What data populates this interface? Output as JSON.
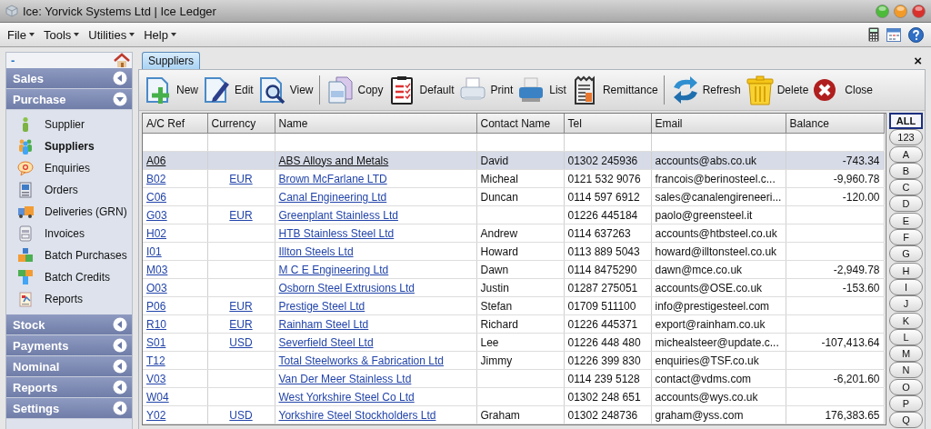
{
  "window": {
    "title": "Ice: Yorvick Systems Ltd | Ice Ledger"
  },
  "menu": [
    "File",
    "Tools",
    "Utilities",
    "Help"
  ],
  "sidebar": {
    "header": "-",
    "sections": [
      {
        "label": "Sales",
        "expanded": false
      },
      {
        "label": "Purchase",
        "expanded": true,
        "items": [
          {
            "label": "Supplier",
            "selected": false
          },
          {
            "label": "Suppliers",
            "selected": true
          },
          {
            "label": "Enquiries",
            "selected": false
          },
          {
            "label": "Orders",
            "selected": false
          },
          {
            "label": "Deliveries (GRN)",
            "selected": false
          },
          {
            "label": "Invoices",
            "selected": false
          },
          {
            "label": "Batch Purchases",
            "selected": false
          },
          {
            "label": "Batch Credits",
            "selected": false
          },
          {
            "label": "Reports",
            "selected": false
          }
        ]
      },
      {
        "label": "Stock",
        "expanded": false
      },
      {
        "label": "Payments",
        "expanded": false
      },
      {
        "label": "Nominal",
        "expanded": false
      },
      {
        "label": "Reports",
        "expanded": false
      },
      {
        "label": "Settings",
        "expanded": false
      }
    ]
  },
  "tabs": [
    {
      "label": "Suppliers",
      "selected": true
    }
  ],
  "close_tab": "×",
  "toolbar_groups": [
    {
      "buttons": [
        "New",
        "Edit",
        "View"
      ]
    },
    {
      "buttons": [
        "Copy",
        "Default",
        "Print",
        "List",
        "Remittance"
      ]
    },
    {
      "buttons": [
        "Refresh",
        "Delete",
        "Close"
      ]
    }
  ],
  "table": {
    "columns": [
      "A/C Ref",
      "Currency",
      "Name",
      "Contact Name",
      "Tel",
      "Email",
      "Balance"
    ],
    "rows": [
      {
        "ref": "A06",
        "currency": "",
        "name": "ABS Alloys and Metals",
        "contact": "David",
        "tel": "01302 245936",
        "email": "accounts@abs.co.uk",
        "balance": "-743.34",
        "selected": true
      },
      {
        "ref": "B02",
        "currency": "EUR",
        "name": "Brown McFarlane LTD",
        "contact": "Micheal",
        "tel": "0121 532 9076",
        "email": "francois@berinosteel.c...",
        "balance": "-9,960.78",
        "selected": false
      },
      {
        "ref": "C06",
        "currency": "",
        "name": "Canal Engineering Ltd",
        "contact": "Duncan",
        "tel": "0114 597 6912",
        "email": "sales@canalengireneeri...",
        "balance": "-120.00",
        "selected": false
      },
      {
        "ref": "G03",
        "currency": "EUR",
        "name": "Greenplant Stainless Ltd",
        "contact": "",
        "tel": "01226 445184",
        "email": "paolo@greensteel.it",
        "balance": "",
        "selected": false
      },
      {
        "ref": "H02",
        "currency": "",
        "name": "HTB Stainless Steel Ltd",
        "contact": "Andrew",
        "tel": "0114 637263",
        "email": "accounts@htbsteel.co.uk",
        "balance": "",
        "selected": false
      },
      {
        "ref": "I01",
        "currency": "",
        "name": "Illton Steels Ltd",
        "contact": "Howard",
        "tel": "0113 889 5043",
        "email": "howard@illtonsteel.co.uk",
        "balance": "",
        "selected": false
      },
      {
        "ref": "M03",
        "currency": "",
        "name": "M C E Engineering Ltd",
        "contact": "Dawn",
        "tel": "0114 8475290",
        "email": "dawn@mce.co.uk",
        "balance": "-2,949.78",
        "selected": false
      },
      {
        "ref": "O03",
        "currency": "",
        "name": "Osborn Steel Extrusions Ltd",
        "contact": "Justin",
        "tel": "01287 275051",
        "email": "accounts@OSE.co.uk",
        "balance": "-153.60",
        "selected": false
      },
      {
        "ref": "P06",
        "currency": "EUR",
        "name": "Prestige Steel Ltd",
        "contact": "Stefan",
        "tel": "01709 511100",
        "email": "info@prestigesteel.com",
        "balance": "",
        "selected": false
      },
      {
        "ref": "R10",
        "currency": "EUR",
        "name": "Rainham Steel Ltd",
        "contact": "Richard",
        "tel": "01226 445371",
        "email": "export@rainham.co.uk",
        "balance": "",
        "selected": false
      },
      {
        "ref": "S01",
        "currency": "USD",
        "name": "Severfield Steel Ltd",
        "contact": "Lee",
        "tel": "01226 448 480",
        "email": "michealsteer@update.c...",
        "balance": "-107,413.64",
        "selected": false
      },
      {
        "ref": "T12",
        "currency": "",
        "name": "Total Steelworks & Fabrication Ltd",
        "contact": "Jimmy",
        "tel": "01226 399 830",
        "email": "enquiries@TSF.co.uk",
        "balance": "",
        "selected": false
      },
      {
        "ref": "V03",
        "currency": "",
        "name": "Van Der Meer Stainless Ltd",
        "contact": "",
        "tel": "0114 239 5128",
        "email": "contact@vdms.com",
        "balance": "-6,201.60",
        "selected": false
      },
      {
        "ref": "W04",
        "currency": "",
        "name": "West Yorkshire Steel Co Ltd",
        "contact": "",
        "tel": "01302 248 651",
        "email": "accounts@wys.co.uk",
        "balance": "",
        "selected": false
      },
      {
        "ref": "Y02",
        "currency": "USD",
        "name": "Yorkshire Steel Stockholders Ltd",
        "contact": "Graham",
        "tel": "01302 248736",
        "email": "graham@yss.com",
        "balance": "176,383.65",
        "selected": false
      }
    ]
  },
  "letters": [
    {
      "label": "ALL",
      "selected": true
    },
    {
      "label": "123",
      "selected": false
    },
    {
      "label": "A",
      "selected": false
    },
    {
      "label": "B",
      "selected": false
    },
    {
      "label": "C",
      "selected": false
    },
    {
      "label": "D",
      "selected": false
    },
    {
      "label": "E",
      "selected": false
    },
    {
      "label": "F",
      "selected": false
    },
    {
      "label": "G",
      "selected": false
    },
    {
      "label": "H",
      "selected": false
    },
    {
      "label": "I",
      "selected": false
    },
    {
      "label": "J",
      "selected": false
    },
    {
      "label": "K",
      "selected": false
    },
    {
      "label": "L",
      "selected": false
    },
    {
      "label": "M",
      "selected": false
    },
    {
      "label": "N",
      "selected": false
    },
    {
      "label": "O",
      "selected": false
    },
    {
      "label": "P",
      "selected": false
    },
    {
      "label": "Q",
      "selected": false
    }
  ]
}
